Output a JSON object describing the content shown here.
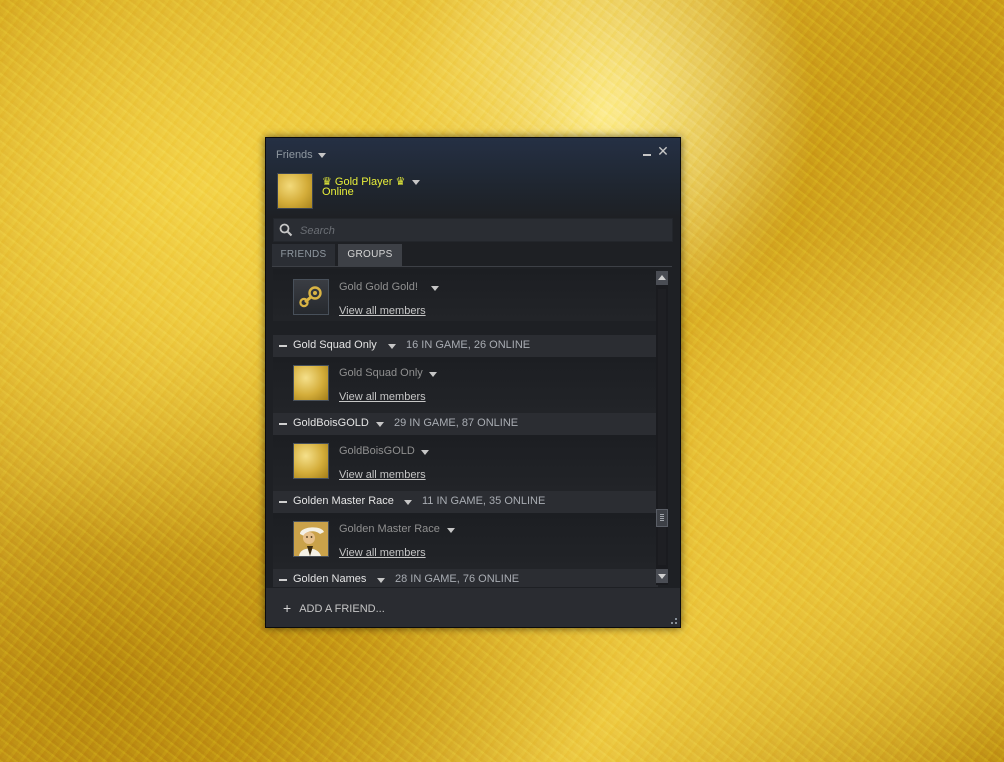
{
  "window": {
    "title": "Friends",
    "minimize_label": "",
    "close_label": "✕"
  },
  "user": {
    "name": "♛ Gold Player ♛",
    "status": "Online"
  },
  "search": {
    "placeholder": "Search",
    "value": ""
  },
  "tabs": {
    "friends": "FRIENDS",
    "groups": "GROUPS",
    "active": "groups"
  },
  "groups": [
    {
      "header": null,
      "row_name": "Gold Gold Gold!",
      "view_label": "View all members",
      "avatar": "steam-logo-icon"
    },
    {
      "header": "Gold Squad Only",
      "stats": "16 IN GAME, 26 ONLINE",
      "row_name": "Gold Squad Only",
      "view_label": "View all members",
      "avatar": "gold-square"
    },
    {
      "header": "GoldBoisGOLD",
      "stats": "29 IN GAME, 87 ONLINE",
      "row_name": "GoldBoisGOLD",
      "view_label": "View all members",
      "avatar": "gold-square"
    },
    {
      "header": "Golden Master Race",
      "stats": "11 IN GAME, 35 ONLINE",
      "row_name": "Golden Master Race",
      "view_label": "View all members",
      "avatar": "character-portrait"
    },
    {
      "header": "Golden Names",
      "stats": "28 IN GAME, 76 ONLINE"
    }
  ],
  "footer": {
    "add_friend": "ADD A FRIEND..."
  },
  "colors": {
    "window_bg": "#1e2024",
    "username": "#e7ee3a",
    "header_bg": "#2b2d32",
    "text": "#c6c6c6"
  }
}
